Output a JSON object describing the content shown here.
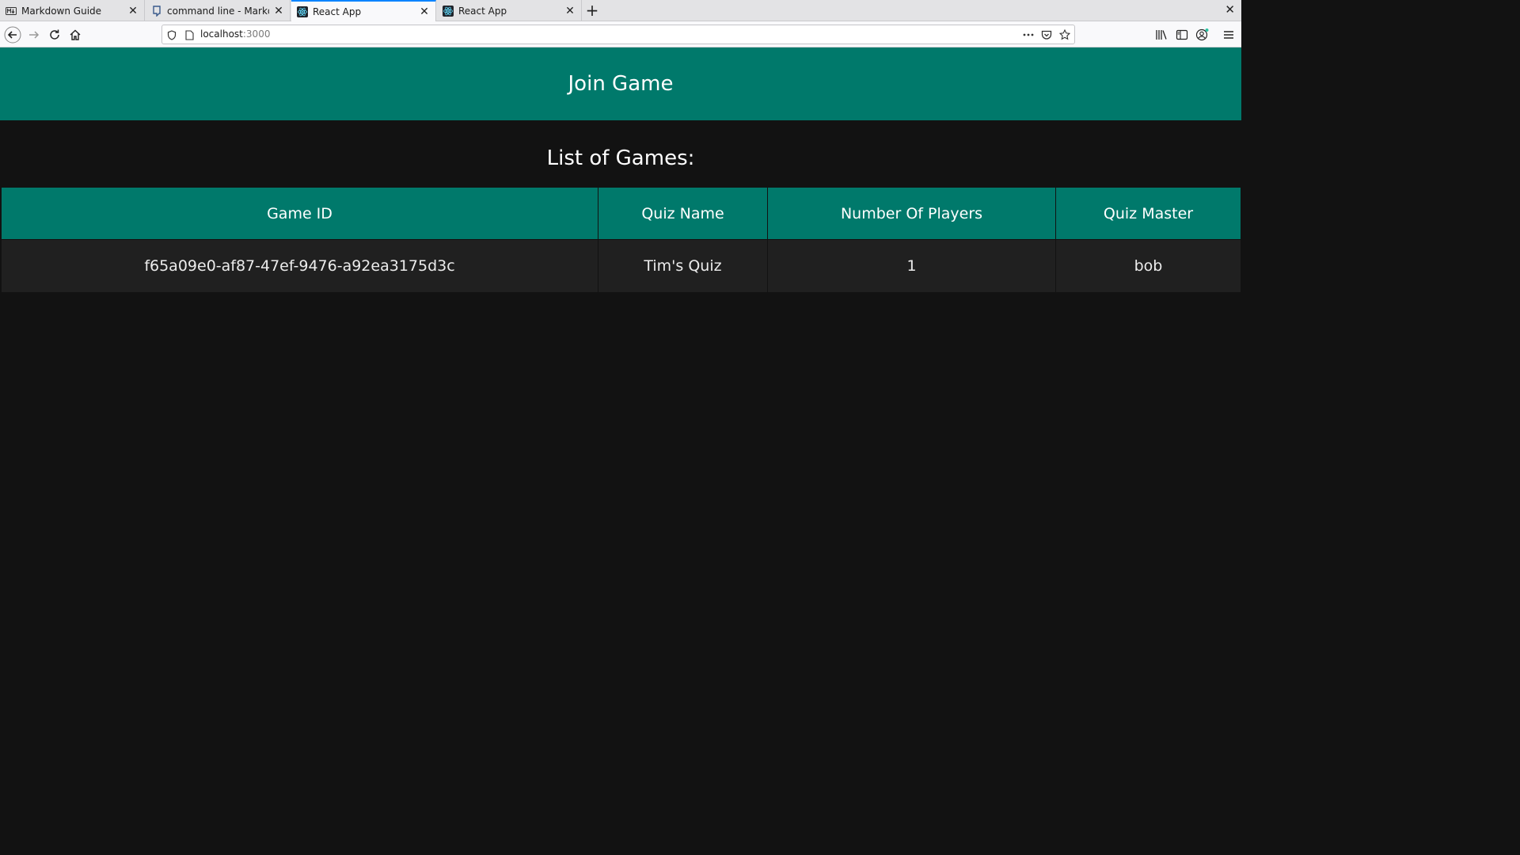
{
  "browser": {
    "tabs": [
      {
        "label": "Markdown Guide",
        "icon": "markdown-icon"
      },
      {
        "label": "command line - Markdow",
        "icon": "stackexchange-icon"
      },
      {
        "label": "React App",
        "icon": "react-icon",
        "active": true
      },
      {
        "label": "React App",
        "icon": "react-icon"
      }
    ],
    "url_host": "localhost",
    "url_port": ":3000"
  },
  "page": {
    "title": "Join Game",
    "subtitle": "List of Games:",
    "accent_color": "#00796b",
    "background_color": "#121212",
    "table": {
      "headers": [
        "Game ID",
        "Quiz Name",
        "Number Of Players",
        "Quiz Master"
      ],
      "rows": [
        [
          "f65a09e0-af87-47ef-9476-a92ea3175d3c",
          "Tim's Quiz",
          "1",
          "bob"
        ]
      ]
    }
  }
}
